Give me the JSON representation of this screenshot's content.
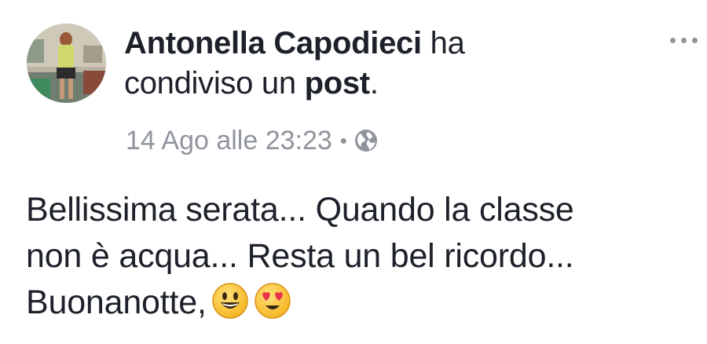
{
  "author": {
    "name": "Antonella Capodieci",
    "action_pre": "ha",
    "action_mid": "condiviso un",
    "action_object": "post",
    "action_end": "."
  },
  "meta": {
    "timestamp": "14 Ago alle 23:23",
    "separator": "•",
    "privacy_icon": "globe-icon"
  },
  "more_menu_icon": "more-options-icon",
  "content": {
    "line1": "Bellissima serata... Quando la classe",
    "line2": "non è acqua... Resta un bel ricordo...",
    "line3": "Buonanotte,",
    "emojis": [
      "grinning-face-emoji",
      "heart-eyes-emoji"
    ]
  },
  "colors": {
    "text": "#1d2129",
    "meta": "#90949c",
    "emoji_yellow": "#ffcc33",
    "emoji_heart": "#e8334a"
  }
}
